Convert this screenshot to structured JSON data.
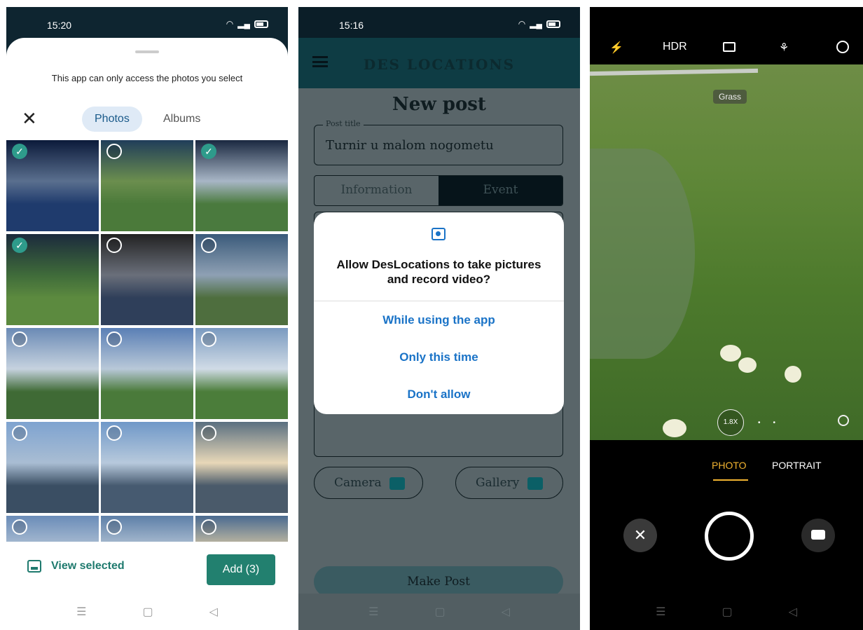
{
  "panel1": {
    "time": "15:20",
    "notice": "This app can only access the photos you select",
    "tabs": {
      "photos": "Photos",
      "albums": "Albums"
    },
    "close_icon": "✕",
    "check_glyph": "✓",
    "view_selected": "View selected",
    "add_button": "Add (3)",
    "selected_cells": [
      0,
      2,
      3
    ],
    "nav": {
      "menu": "☰",
      "home": "▢",
      "back": "◁"
    }
  },
  "panel2": {
    "time": "15:16",
    "app_title": "DES LOCATIONS",
    "page_title": "New post",
    "field_label": "Post title",
    "field_value": "Turnir u malom nogometu",
    "seg_info": "Information",
    "seg_event": "Event",
    "camera_label": "Camera",
    "gallery_label": "Gallery",
    "make_post": "Make Post",
    "dialog": {
      "message": "Allow DesLocations to take pictures and record video?",
      "opt1": "While using the app",
      "opt2": "Only this time",
      "opt3": "Don't allow"
    },
    "nav": {
      "menu": "☰",
      "home": "▢",
      "back": "◁"
    }
  },
  "panel3": {
    "flash": "⚡",
    "hdr": "HDR",
    "grass_label": "Grass",
    "zoom": "1.8X",
    "mode_photo": "PHOTO",
    "mode_portrait": "PORTRAIT",
    "cancel_glyph": "✕",
    "nav": {
      "menu": "☰",
      "home": "▢",
      "back": "◁"
    }
  },
  "colors": {
    "accent_green": "#22806f",
    "dialog_blue": "#1a73c7",
    "camera_mode_active": "#f2b431"
  }
}
